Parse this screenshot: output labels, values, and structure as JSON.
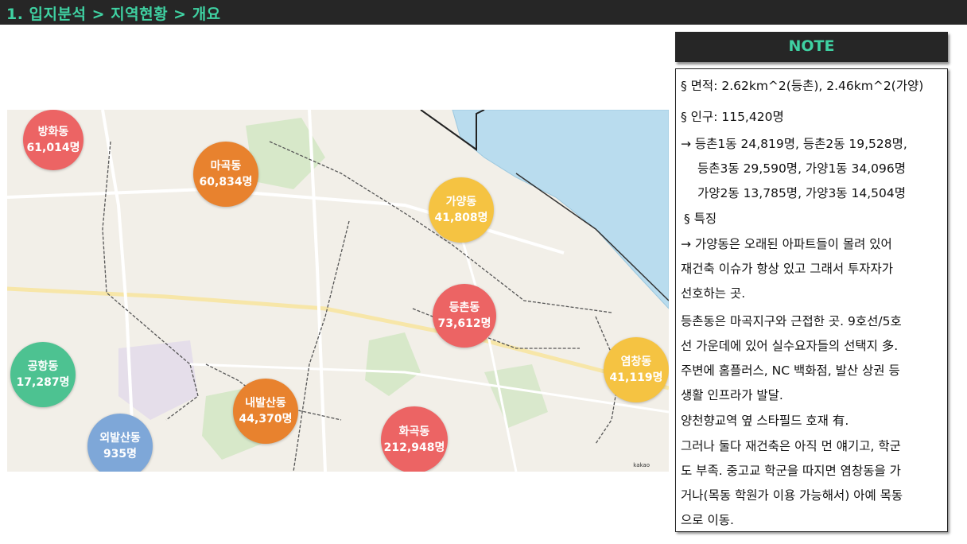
{
  "header": {
    "title": "1. 입지분석 > 지역현황 > 개요"
  },
  "note": {
    "title": "NOTE",
    "lines": [
      "§ 면적: 2.62km^2(등촌), 2.46km^2(가양)",
      "§ 인구: 115,420명",
      "→ 등촌1동 24,819명, 등촌2동 19,528명,",
      "등촌3동 29,590명, 가양1동 34,096명",
      "가양2동 13,785명, 가양3동 14,504명",
      "§ 특징",
      "→ 가양동은 오래된 아파트들이 몰려 있어",
      "재건축 이슈가 항상 있고 그래서 투자자가",
      "선호하는 곳.",
      "등촌동은 마곡지구와 근접한 곳. 9호선/5호",
      "선 가운데에 있어 실수요자들의 선택지 多.",
      "주변에 홈플러스, NC 백화점, 발산 상권 등",
      "생활 인프라가 발달.",
      "양천향교역 옆 스타필드 호재 有.",
      "그러나 둘다 재건축은 아직 먼 얘기고, 학군",
      "도 부족. 중고교 학군을 따지면 염창동을 가",
      "거나(목동 학원가 이용 가능해서) 아예 목동",
      "으로 이동."
    ]
  },
  "map": {
    "attribution": "kakao",
    "colors": {
      "red": "#ec6464",
      "orange": "#e8822e",
      "yellow": "#f5c342",
      "green": "#4dc291",
      "blue": "#7ea7d8",
      "river": "#b9dcee"
    },
    "districts": [
      {
        "name": "방화동",
        "population": "61,014명",
        "color": "red"
      },
      {
        "name": "마곡동",
        "population": "60,834명",
        "color": "orange"
      },
      {
        "name": "가양동",
        "population": "41,808명",
        "color": "yellow"
      },
      {
        "name": "등촌동",
        "population": "73,612명",
        "color": "red"
      },
      {
        "name": "공항동",
        "population": "17,287명",
        "color": "green"
      },
      {
        "name": "내발산동",
        "population": "44,370명",
        "color": "orange"
      },
      {
        "name": "화곡동",
        "population": "212,948명",
        "color": "red"
      },
      {
        "name": "염창동",
        "population": "41,119명",
        "color": "yellow"
      },
      {
        "name": "외발산동",
        "population": "935명",
        "color": "blue"
      }
    ]
  }
}
